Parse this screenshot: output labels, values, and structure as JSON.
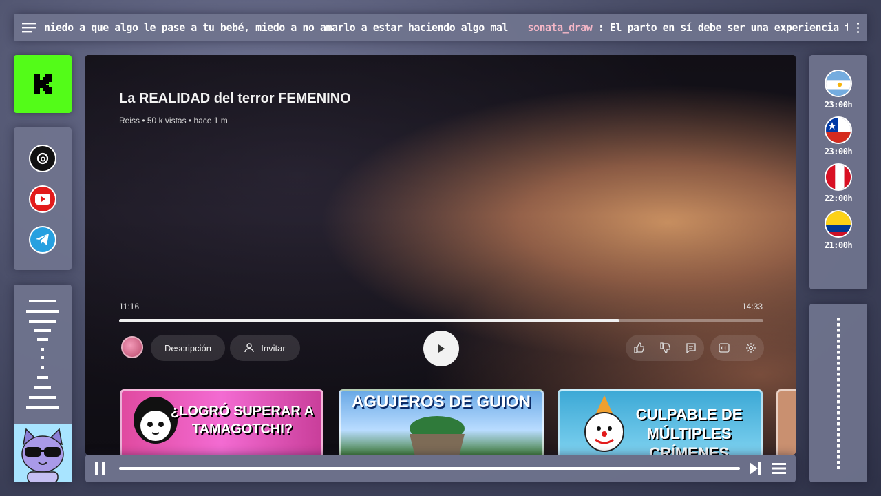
{
  "chat": {
    "messages": [
      {
        "user": "",
        "text": "niedo a que algo le pase a tu bebé, miedo a no amarlo a estar haciendo algo mal"
      },
      {
        "user": "sonata_draw",
        "text": " : El parto en sí debe ser una experiencia traumatica en sí"
      }
    ]
  },
  "video": {
    "title": "La REALIDAD del terror FEMENINO",
    "channel": "Reiss",
    "meta": " • 50 k vistas • hace 1 m",
    "current_time": "11:16",
    "total_time": "14:33",
    "progress": 0.777,
    "description_label": "Descripción",
    "invite_label": "Invitar"
  },
  "thumbnails": [
    {
      "text": "¿LOGRÓ SUPERAR A TAMAGOTCHI?"
    },
    {
      "text": "AGUJEROS DE GUION"
    },
    {
      "text": "CULPABLE DE MÚLTIPLES CRÍMENES"
    }
  ],
  "clocks": [
    {
      "country": "argentina-flag",
      "time": "23:00h"
    },
    {
      "country": "chile-flag",
      "time": "23:00h"
    },
    {
      "country": "peru-flag",
      "time": "22:00h"
    },
    {
      "country": "colombia-flag",
      "time": "21:00h"
    }
  ],
  "colors": {
    "kick_green": "#53fc18",
    "chat_user": "#f4b6c6"
  }
}
